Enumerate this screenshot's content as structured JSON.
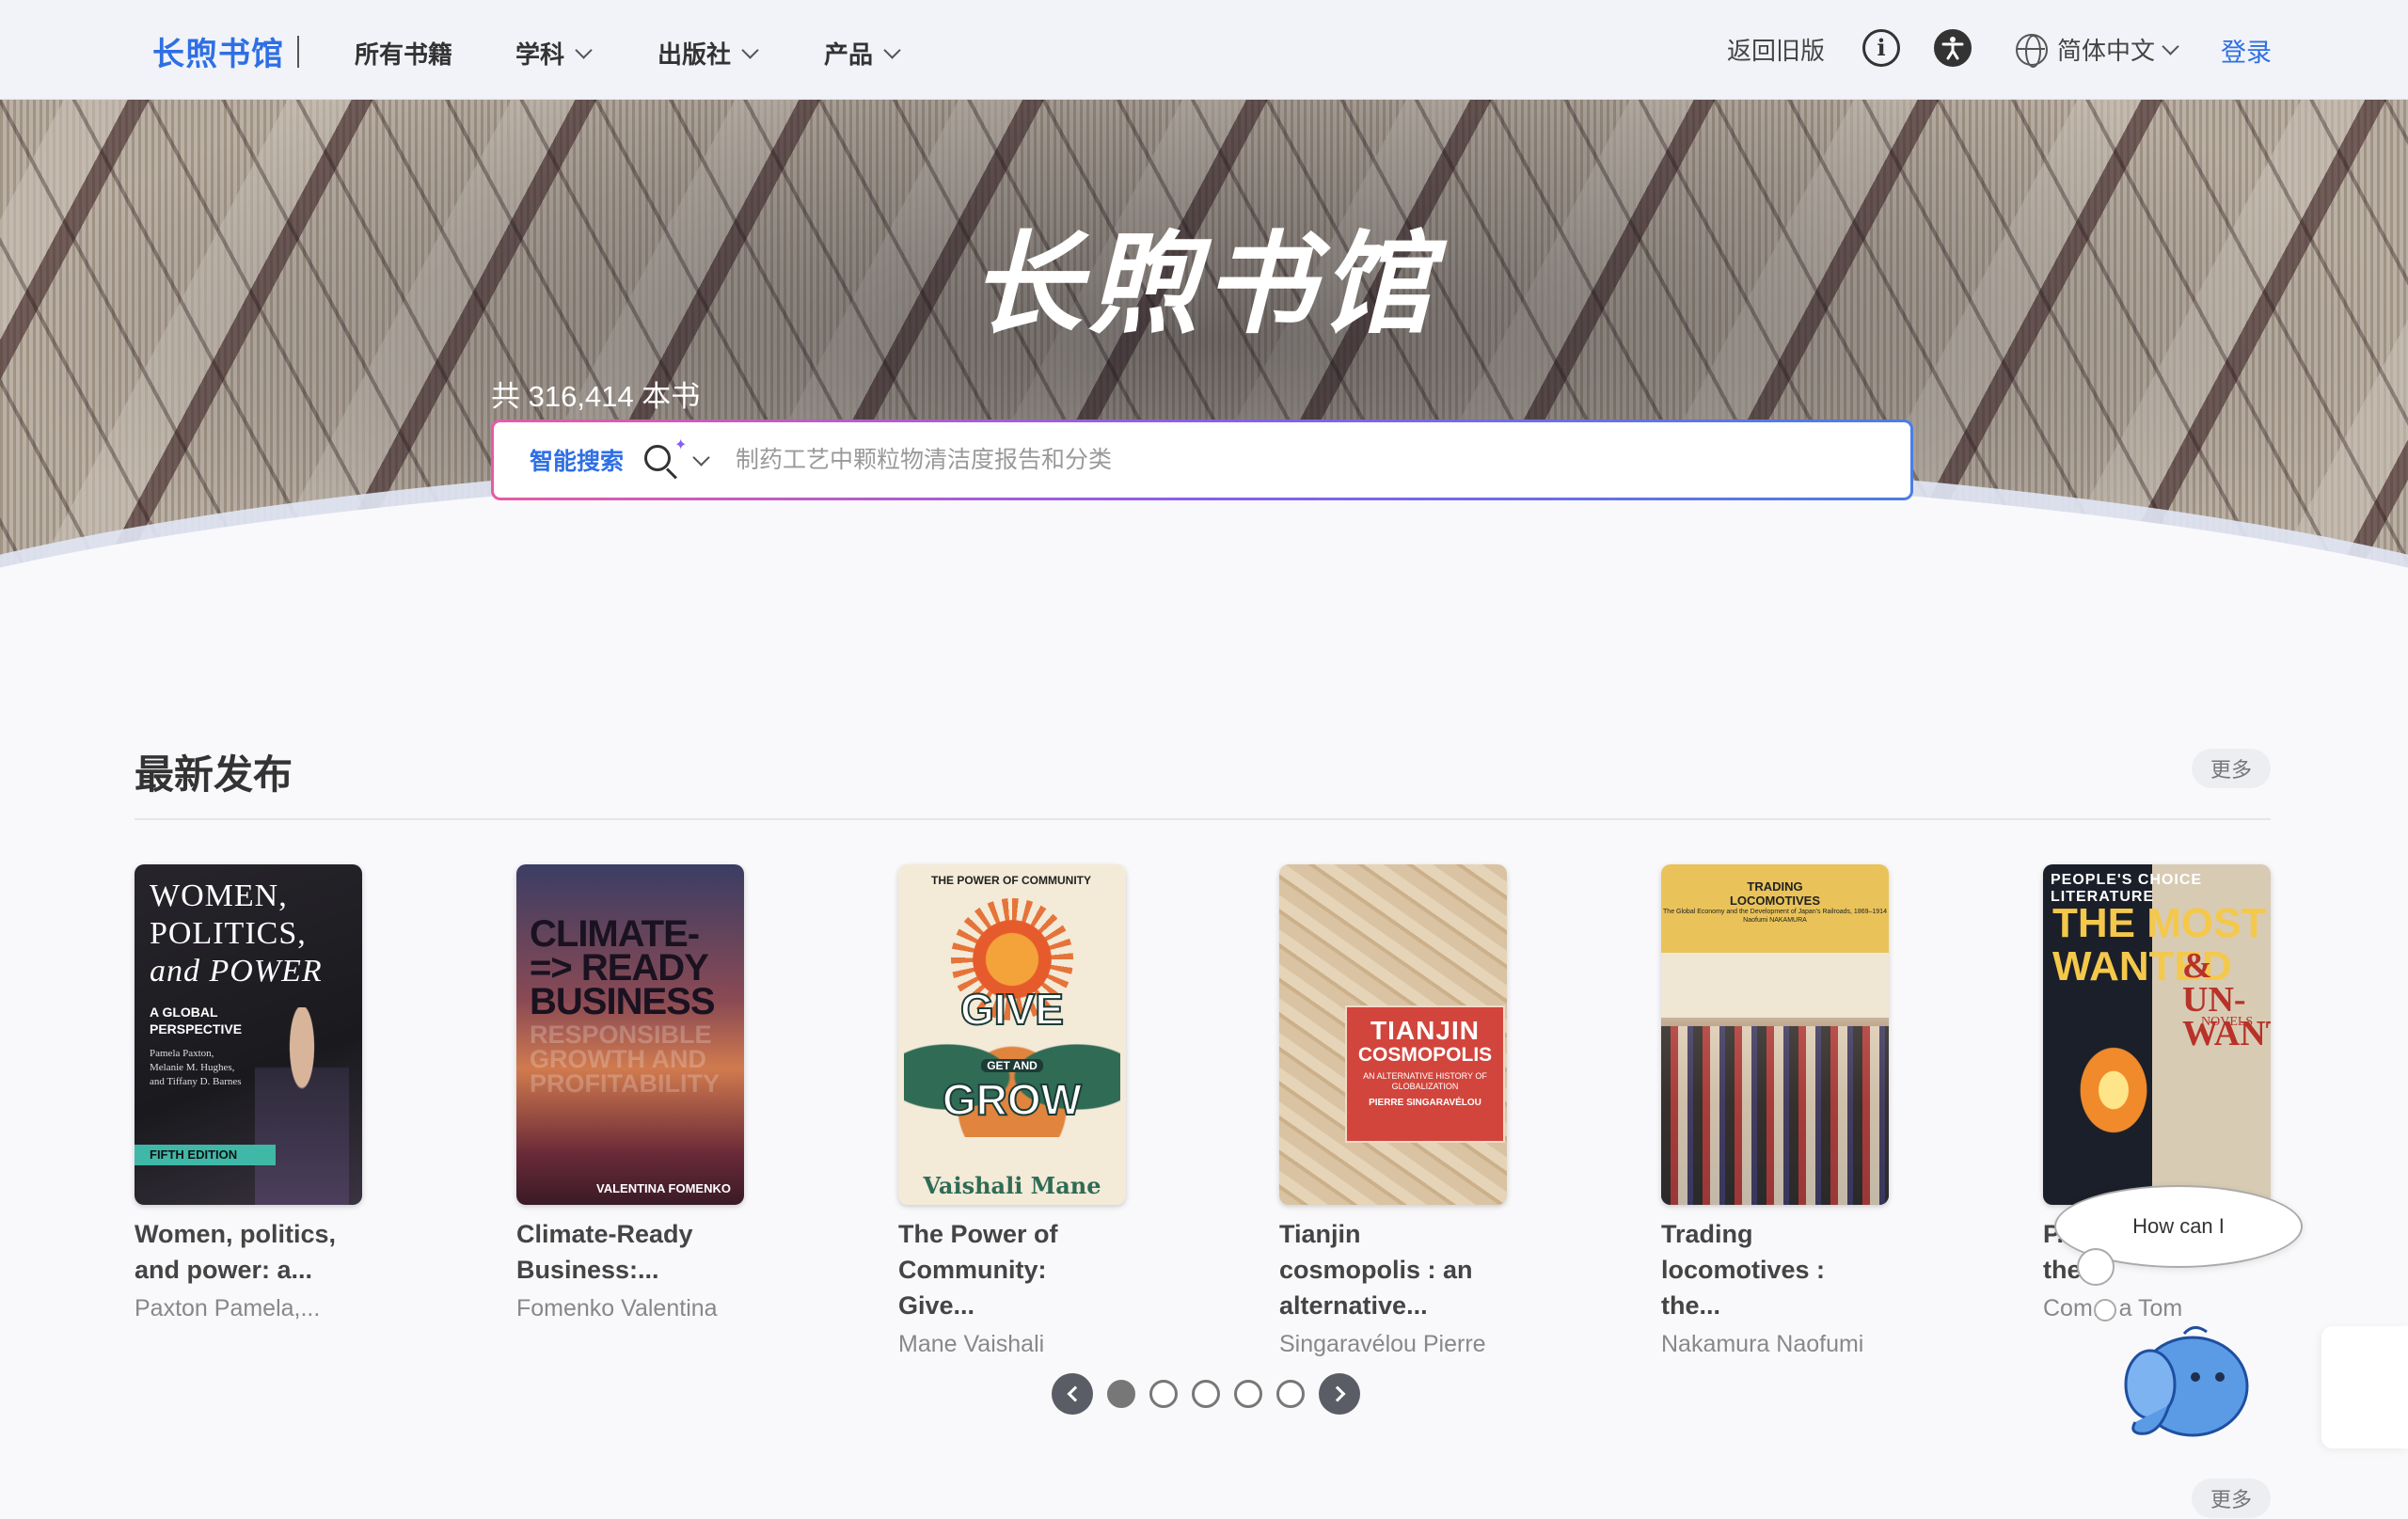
{
  "nav": {
    "brand": "长煦书馆",
    "items": [
      {
        "label": "所有书籍",
        "dropdown": false
      },
      {
        "label": "学科",
        "dropdown": true
      },
      {
        "label": "出版社",
        "dropdown": true
      },
      {
        "label": "产品",
        "dropdown": true
      }
    ],
    "old_version": "返回旧版",
    "info_icon": "info-icon",
    "accessibility_icon": "accessibility-icon",
    "language": "简体中文",
    "login": "登录"
  },
  "hero": {
    "logo_text": "长煦书馆",
    "book_count": "共 316,414 本书",
    "search": {
      "mode": "智能搜索",
      "placeholder": "制药工艺中颗粒物清洁度报告和分类"
    }
  },
  "section": {
    "title": "最新发布",
    "more": "更多",
    "books": [
      {
        "title": "Women, politics, and power: a...",
        "author": "Paxton Pamela,...",
        "cover": {
          "lines": [
            "WOMEN,",
            "POLITICS,",
            "and POWER"
          ],
          "subtitle": "A GLOBAL PERSPECTIVE",
          "authors": "Pamela Paxton, Melanie M. Hughes, and Tiffany D. Barnes",
          "edition": "FIFTH EDITION"
        }
      },
      {
        "title": "Climate-Ready Business:...",
        "author": "Fomenko Valentina",
        "cover": {
          "lines": [
            "CLIMATE-",
            "=> READY",
            "BUSINESS"
          ],
          "subtitle": "RESPONSIBLE GROWTH AND PROFITABILITY",
          "authors": "VALENTINA FOMENKO"
        }
      },
      {
        "title": "The Power of Community: Give...",
        "author": "Mane Vaishali",
        "cover": {
          "arc": "THE POWER OF COMMUNITY",
          "lines": [
            "GIVE",
            "GROW"
          ],
          "get": "GET AND",
          "authors": "Vaishali Mane"
        }
      },
      {
        "title": "Tianjin cosmopolis : an alternative...",
        "author": "Singaravélou Pierre",
        "cover": {
          "lines": [
            "TIANJIN",
            "COSMOPOLIS"
          ],
          "subtitle": "AN ALTERNATIVE HISTORY OF GLOBALIZATION",
          "authors": "PIERRE SINGARAVÉLOU"
        }
      },
      {
        "title": "Trading locomotives : the...",
        "author": "Nakamura Naofumi",
        "cover": {
          "lines": [
            "TRADING",
            "LOCOMOTIVES"
          ],
          "subtitle": "The Global Economy and the Development of Japan's Railroads, 1869–1914",
          "authors": "Naofumi NAKAMURA"
        }
      },
      {
        "title": "P... literature : the...",
        "author": "Com... a Tom",
        "cover": {
          "top": "PEOPLE'S CHOICE LITERATURE",
          "lines": [
            "THE MOST",
            "WANTED"
          ],
          "un": "& UN-WANTED",
          "novels": "NOVELS"
        }
      }
    ]
  },
  "pagination": {
    "pages": 5,
    "current": 1
  },
  "chat": {
    "prompt": "How can I"
  },
  "second_section": {
    "more": "更多"
  }
}
